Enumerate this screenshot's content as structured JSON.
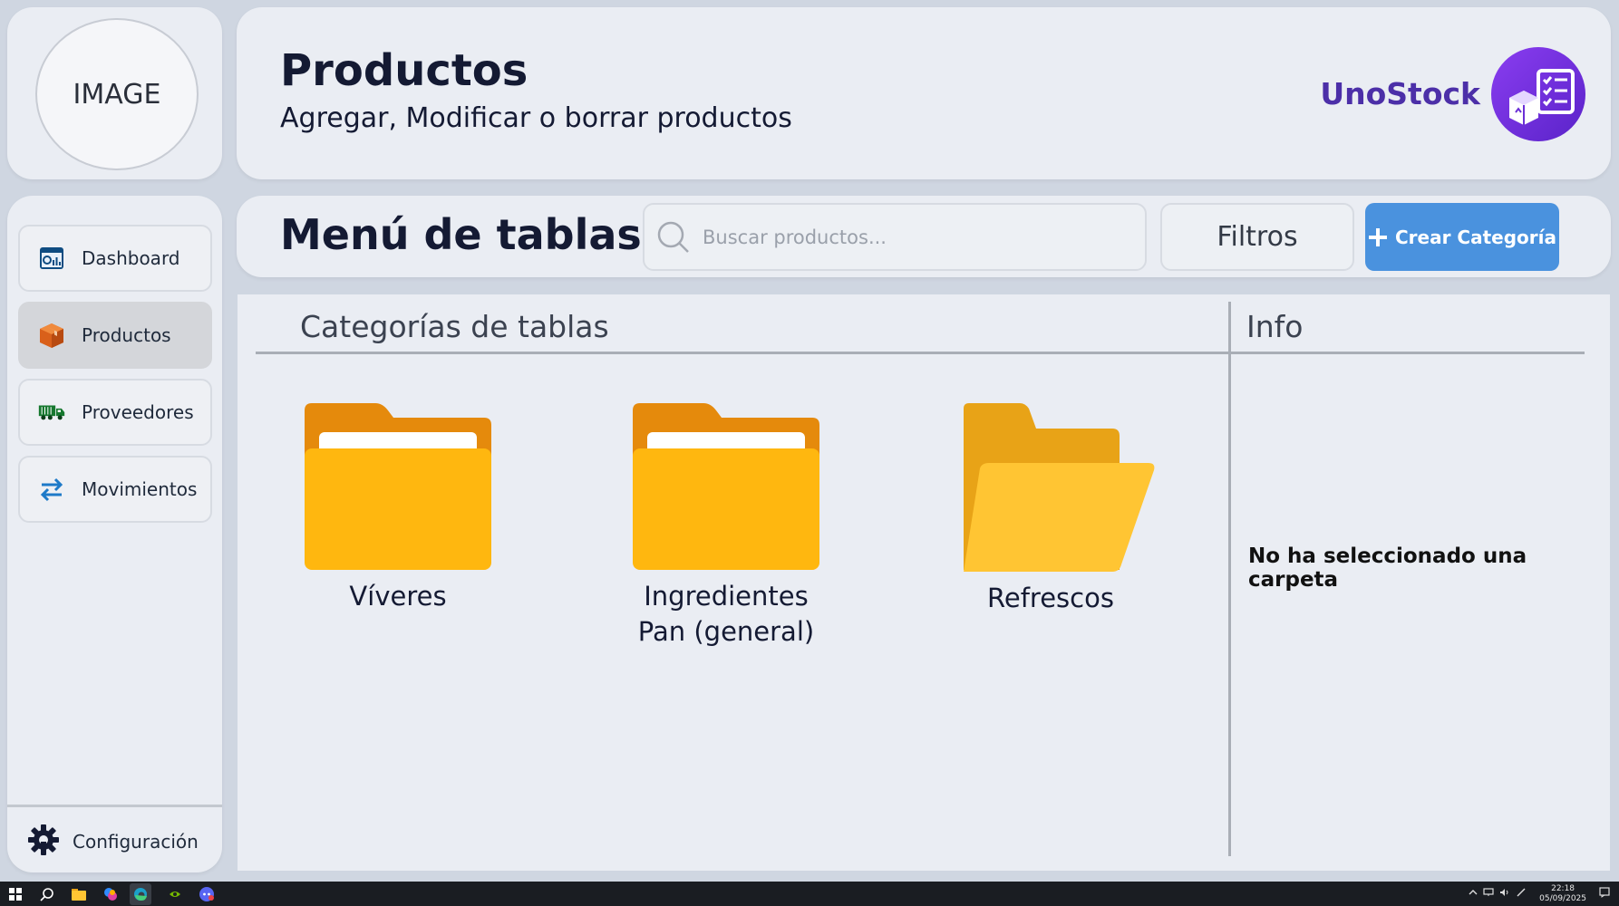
{
  "avatar": {
    "placeholder": "IMAGE"
  },
  "header": {
    "title": "Productos",
    "subtitle": "Agregar, Modificar o borrar productos",
    "brand": "UnoStock",
    "brand_color": "#4c2fa8"
  },
  "sidebar": {
    "items": [
      {
        "label": "Dashboard",
        "icon": "dashboard-icon",
        "active": false
      },
      {
        "label": "Productos",
        "icon": "box-icon",
        "active": true
      },
      {
        "label": "Proveedores",
        "icon": "truck-icon",
        "active": false
      },
      {
        "label": "Movimientos",
        "icon": "transfer-arrows-icon",
        "active": false
      }
    ],
    "config_label": "Configuración"
  },
  "toolbar": {
    "title": "Menú de tablas",
    "search_placeholder": "Buscar productos...",
    "filters_label": "Filtros",
    "create_label": "Crear Categoría",
    "create_color": "#4a92de"
  },
  "main": {
    "categories_heading": "Categorías de tablas",
    "info_heading": "Info",
    "folders": [
      {
        "label_lines": [
          "Víveres"
        ],
        "icon": "folder-icon"
      },
      {
        "label_lines": [
          "Ingredientes",
          "Pan (general)"
        ],
        "icon": "folder-icon"
      },
      {
        "label_lines": [
          "Refrescos"
        ],
        "icon": "folder-open-icon"
      }
    ],
    "info_message": "No ha seleccionado una carpeta"
  },
  "taskbar": {
    "time": "22:18",
    "date": "05/09/2025"
  }
}
